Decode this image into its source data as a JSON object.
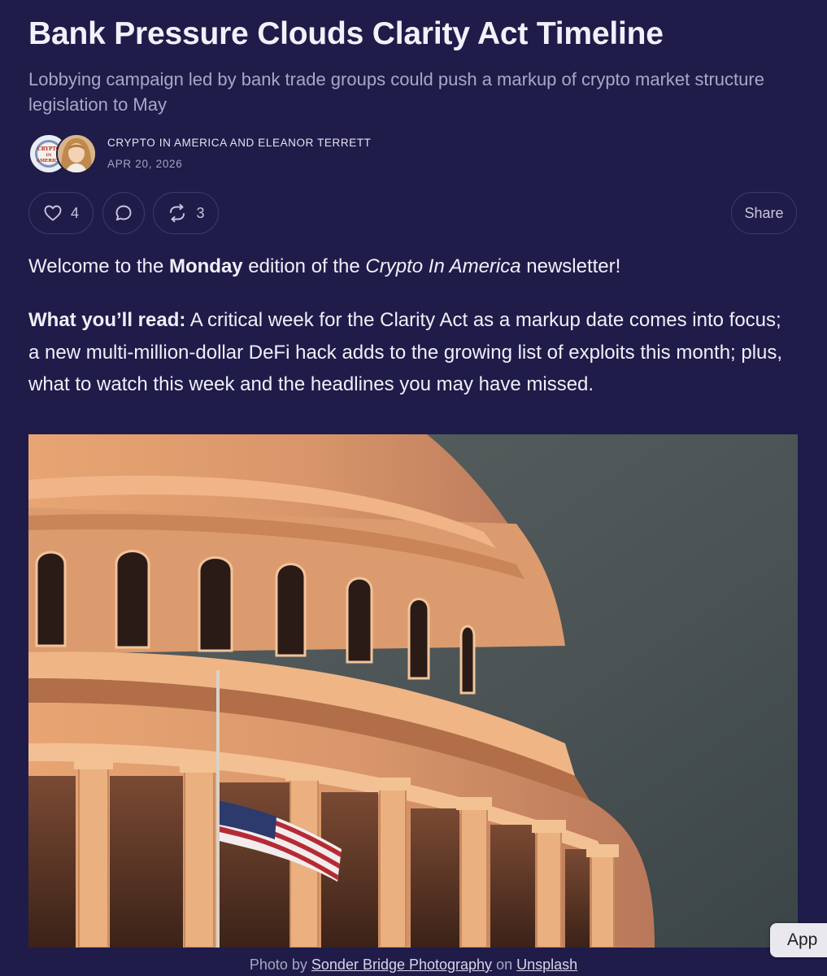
{
  "article": {
    "title": "Bank Pressure Clouds Clarity Act Timeline",
    "subtitle": "Lobbying campaign led by bank trade groups could push a markup of crypto market structure legislation to May",
    "byline": "CRYPTO IN AMERICA AND ELEANOR TERRETT",
    "date": "APR 20, 2026",
    "avatar_logo_text": "CRYPTO IN AMERICA"
  },
  "actions": {
    "like_count": "4",
    "restack_count": "3",
    "share_label": "Share",
    "icons": [
      "heart-icon",
      "comment-icon",
      "restack-icon"
    ]
  },
  "body": {
    "intro_pre": "Welcome to the ",
    "intro_bold": "Monday",
    "intro_mid": " edition of the ",
    "intro_italic": "Crypto In America",
    "intro_post": " newsletter!",
    "read_label": "What you’ll read:",
    "read_text": " A critical week for the Clarity Act as a markup date comes into focus; a new multi-million-dollar DeFi hack adds to the growing list of exploits this month; plus, what to watch this week and the headlines you may have missed."
  },
  "caption": {
    "prefix": "Photo by ",
    "photographer": "Sonder Bridge Photography",
    "middle": " on ",
    "source": "Unsplash"
  },
  "app_tab": {
    "label": "App"
  },
  "colors": {
    "background": "#1f1c4a",
    "text": "#f0eff8",
    "muted": "#a9a7c6",
    "pill_border": "#3e3a6e"
  }
}
